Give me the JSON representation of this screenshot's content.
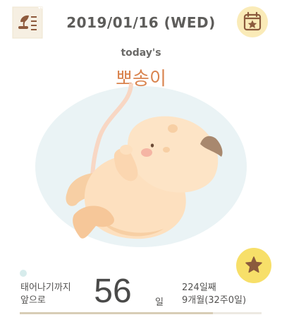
{
  "header": {
    "date": "2019/01/16 (WED)",
    "menu_icon": "sprout-list-icon",
    "calendar_icon": "calendar-star-icon"
  },
  "baby": {
    "today_label": "today's",
    "name": "뽀송이"
  },
  "countdown": {
    "caption_line1": "태어나기까지",
    "caption_line2": "앞으로",
    "days_left": "56",
    "unit": "일",
    "day_count": "224일째",
    "month_week": "9개월(32주0일)",
    "progress_fraction": 0.8
  },
  "favorite_icon": "star-icon",
  "colors": {
    "name_accent": "#d9834e",
    "calendar_bg": "#faebb8",
    "star_bg": "#f7df69",
    "womb_bg": "#eaf3f5",
    "progress": "#d8cdb6"
  }
}
